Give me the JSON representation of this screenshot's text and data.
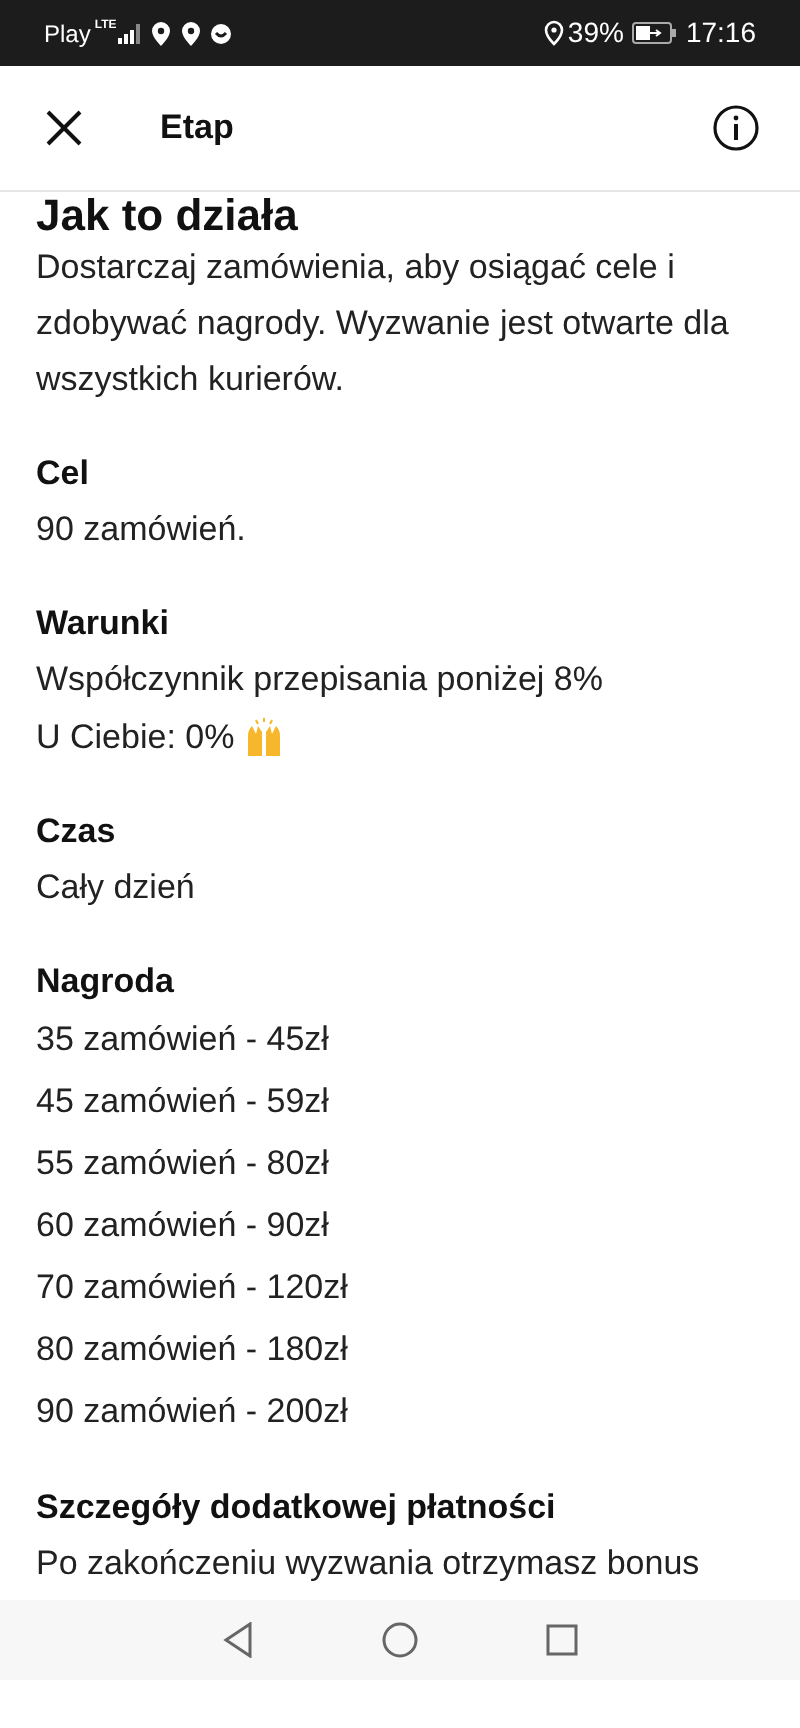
{
  "status_bar": {
    "carrier": "Play",
    "network": "LTE",
    "battery": "39%",
    "time": "17:16"
  },
  "header": {
    "title": "Etap"
  },
  "heading": "Jak to działa",
  "intro": "Dostarczaj zamówienia, aby osiągać cele i zdobywać nagrody. Wyzwanie jest otwarte dla wszystkich kurierów.",
  "sections": [
    {
      "title": "Cel",
      "kind": "plain",
      "lines": [
        {
          "text": "90 zamówień.",
          "kind": "text"
        }
      ]
    },
    {
      "title": "Warunki",
      "kind": "plain",
      "lines": [
        {
          "text": "Współczynnik przepisania poniżej 8%",
          "kind": "text"
        },
        {
          "text": "U Ciebie: 0%",
          "kind": "text_with_icon"
        }
      ]
    },
    {
      "title": "Czas",
      "kind": "plain",
      "lines": [
        {
          "text": "Cały dzień",
          "kind": "text"
        }
      ]
    },
    {
      "title": "Nagroda",
      "kind": "list",
      "lines": [
        {
          "text": "35 zamówień - 45zł",
          "kind": "text"
        },
        {
          "text": "45 zamówień - 59zł",
          "kind": "text"
        },
        {
          "text": "55 zamówień - 80zł",
          "kind": "text"
        },
        {
          "text": "60 zamówień - 90zł",
          "kind": "text"
        },
        {
          "text": "70 zamówień - 120zł",
          "kind": "text"
        },
        {
          "text": "80 zamówień - 180zł",
          "kind": "text"
        },
        {
          "text": "90 zamówień - 200zł",
          "kind": "text"
        }
      ]
    },
    {
      "title": "Szczegóły dodatkowej płatności",
      "kind": "plain",
      "lines": [
        {
          "text": "Po zakończeniu wyzwania otrzymasz bonus",
          "kind": "text"
        }
      ]
    }
  ]
}
